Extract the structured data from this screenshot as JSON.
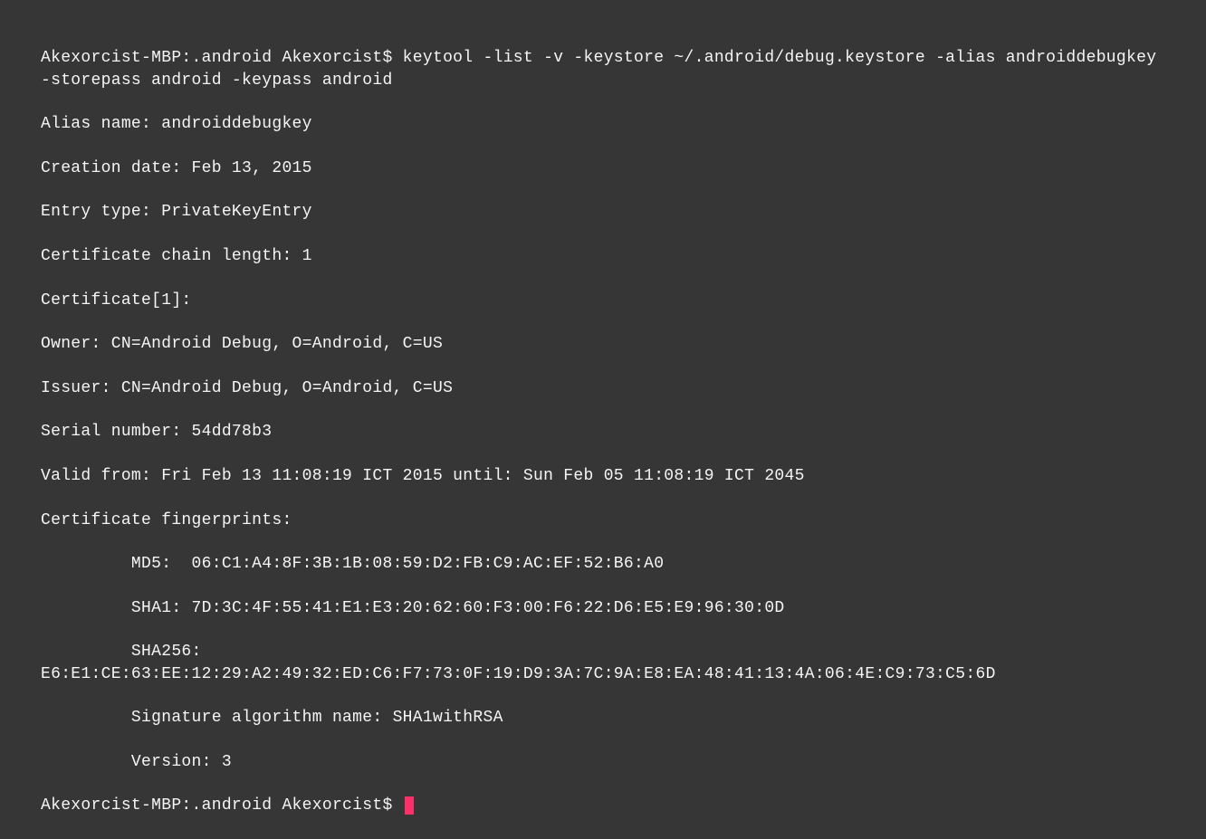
{
  "terminal": {
    "prompt1": "Akexorcist-MBP:.android Akexorcist$ ",
    "command": "keytool -list -v -keystore ~/.android/debug.keystore -alias androiddebugkey -storepass android -keypass android",
    "output": {
      "alias_name": "Alias name: androiddebugkey",
      "creation_date": "Creation date: Feb 13, 2015",
      "entry_type": "Entry type: PrivateKeyEntry",
      "chain_length": "Certificate chain length: 1",
      "cert_header": "Certificate[1]:",
      "owner": "Owner: CN=Android Debug, O=Android, C=US",
      "issuer": "Issuer: CN=Android Debug, O=Android, C=US",
      "serial": "Serial number: 54dd78b3",
      "valid": "Valid from: Fri Feb 13 11:08:19 ICT 2015 until: Sun Feb 05 11:08:19 ICT 2045",
      "fingerprints_header": "Certificate fingerprints:",
      "md5": "         MD5:  06:C1:A4:8F:3B:1B:08:59:D2:FB:C9:AC:EF:52:B6:A0",
      "sha1": "         SHA1: 7D:3C:4F:55:41:E1:E3:20:62:60:F3:00:F6:22:D6:E5:E9:96:30:0D",
      "sha256": "         SHA256: E6:E1:CE:63:EE:12:29:A2:49:32:ED:C6:F7:73:0F:19:D9:3A:7C:9A:E8:EA:48:41:13:4A:06:4E:C9:73:C5:6D",
      "sig_alg": "         Signature algorithm name: SHA1withRSA",
      "version": "         Version: 3"
    },
    "prompt2": "Akexorcist-MBP:.android Akexorcist$ "
  }
}
